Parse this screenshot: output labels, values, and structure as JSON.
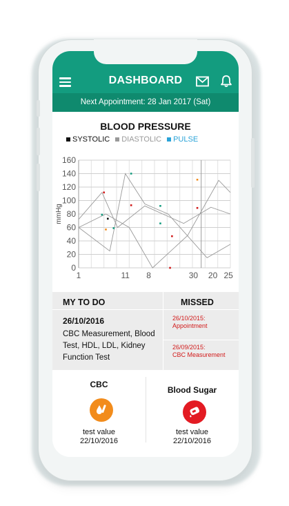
{
  "header": {
    "title": "DASHBOARD",
    "menu_icon": "hamburger-icon",
    "mail_icon": "mail-icon",
    "notification_icon": "bell-icon"
  },
  "appointment": {
    "text": "Next Appointment: 28 Jan 2017 (Sat)"
  },
  "colors": {
    "brand": "#139c7f",
    "brand_dark": "#0f8a6e",
    "systolic": "#111111",
    "diastolic": "#999999",
    "pulse": "#2aa3d8",
    "missed": "#d11a1a",
    "cbc_icon_bg": "#f28c1c",
    "sugar_icon_bg": "#e31b23"
  },
  "chart_data": {
    "type": "line",
    "title": "BLOOD PRESSURE",
    "ylabel": "mmHg",
    "xlabel": "",
    "ylim": [
      0,
      160
    ],
    "y_ticks": [
      0,
      20,
      40,
      60,
      80,
      100,
      120,
      140,
      160
    ],
    "x_ticks": [
      "1",
      "11",
      "8",
      "30",
      "20",
      "25"
    ],
    "legend": [
      {
        "name": "SYSTOLIC",
        "color": "#111111"
      },
      {
        "name": "DIASTOLIC",
        "color": "#999999"
      },
      {
        "name": "PULSE",
        "color": "#2aa3d8"
      }
    ],
    "series": [
      {
        "x": [
          1,
          9,
          13,
          18,
          24,
          34,
          40
        ],
        "y": [
          60,
          25,
          140,
          95,
          80,
          15,
          35
        ],
        "color": "#999999"
      },
      {
        "x": [
          1,
          7,
          11,
          18,
          28,
          35,
          40
        ],
        "y": [
          72,
          112,
          60,
          92,
          66,
          90,
          80
        ],
        "color": "#999999"
      },
      {
        "x": [
          1,
          8,
          14,
          20,
          29,
          37,
          40
        ],
        "y": [
          60,
          80,
          60,
          0,
          48,
          130,
          112
        ],
        "color": "#999999"
      }
    ],
    "points": [
      {
        "x": 7.5,
        "y": 112,
        "color": "#d11a1a"
      },
      {
        "x": 7,
        "y": 79,
        "color": "#139c7f"
      },
      {
        "x": 8.5,
        "y": 73,
        "color": "#111111"
      },
      {
        "x": 8,
        "y": 57,
        "color": "#f28c1c"
      },
      {
        "x": 10,
        "y": 59,
        "color": "#139c7f"
      },
      {
        "x": 14.5,
        "y": 140,
        "color": "#139c7f"
      },
      {
        "x": 14.5,
        "y": 93,
        "color": "#d11a1a"
      },
      {
        "x": 22,
        "y": 92,
        "color": "#139c7f"
      },
      {
        "x": 22,
        "y": 66,
        "color": "#139c7f"
      },
      {
        "x": 25,
        "y": 47,
        "color": "#d11a1a"
      },
      {
        "x": 24.5,
        "y": 0,
        "color": "#d11a1a"
      },
      {
        "x": 31.5,
        "y": 131,
        "color": "#f28c1c"
      },
      {
        "x": 31.5,
        "y": 89,
        "color": "#d11a1a"
      }
    ]
  },
  "todo": {
    "heading": "MY TO DO",
    "date": "26/10/2016",
    "text": "CBC Measurement, Blood Test, HDL, LDL, Kidney Function Test"
  },
  "missed": {
    "heading": "MISSED",
    "items": [
      {
        "date": "26/10/2015:",
        "label": "Appointment"
      },
      {
        "date": "26/09/2015:",
        "label": "CBC Measurement"
      }
    ]
  },
  "tests": [
    {
      "name": "CBC",
      "icon": "blood-drop-icon",
      "value_label": "test value",
      "date": "22/10/2016"
    },
    {
      "name": "Blood Sugar",
      "icon": "glucose-meter-icon",
      "value_label": "test value",
      "date": "22/10/2016"
    }
  ]
}
